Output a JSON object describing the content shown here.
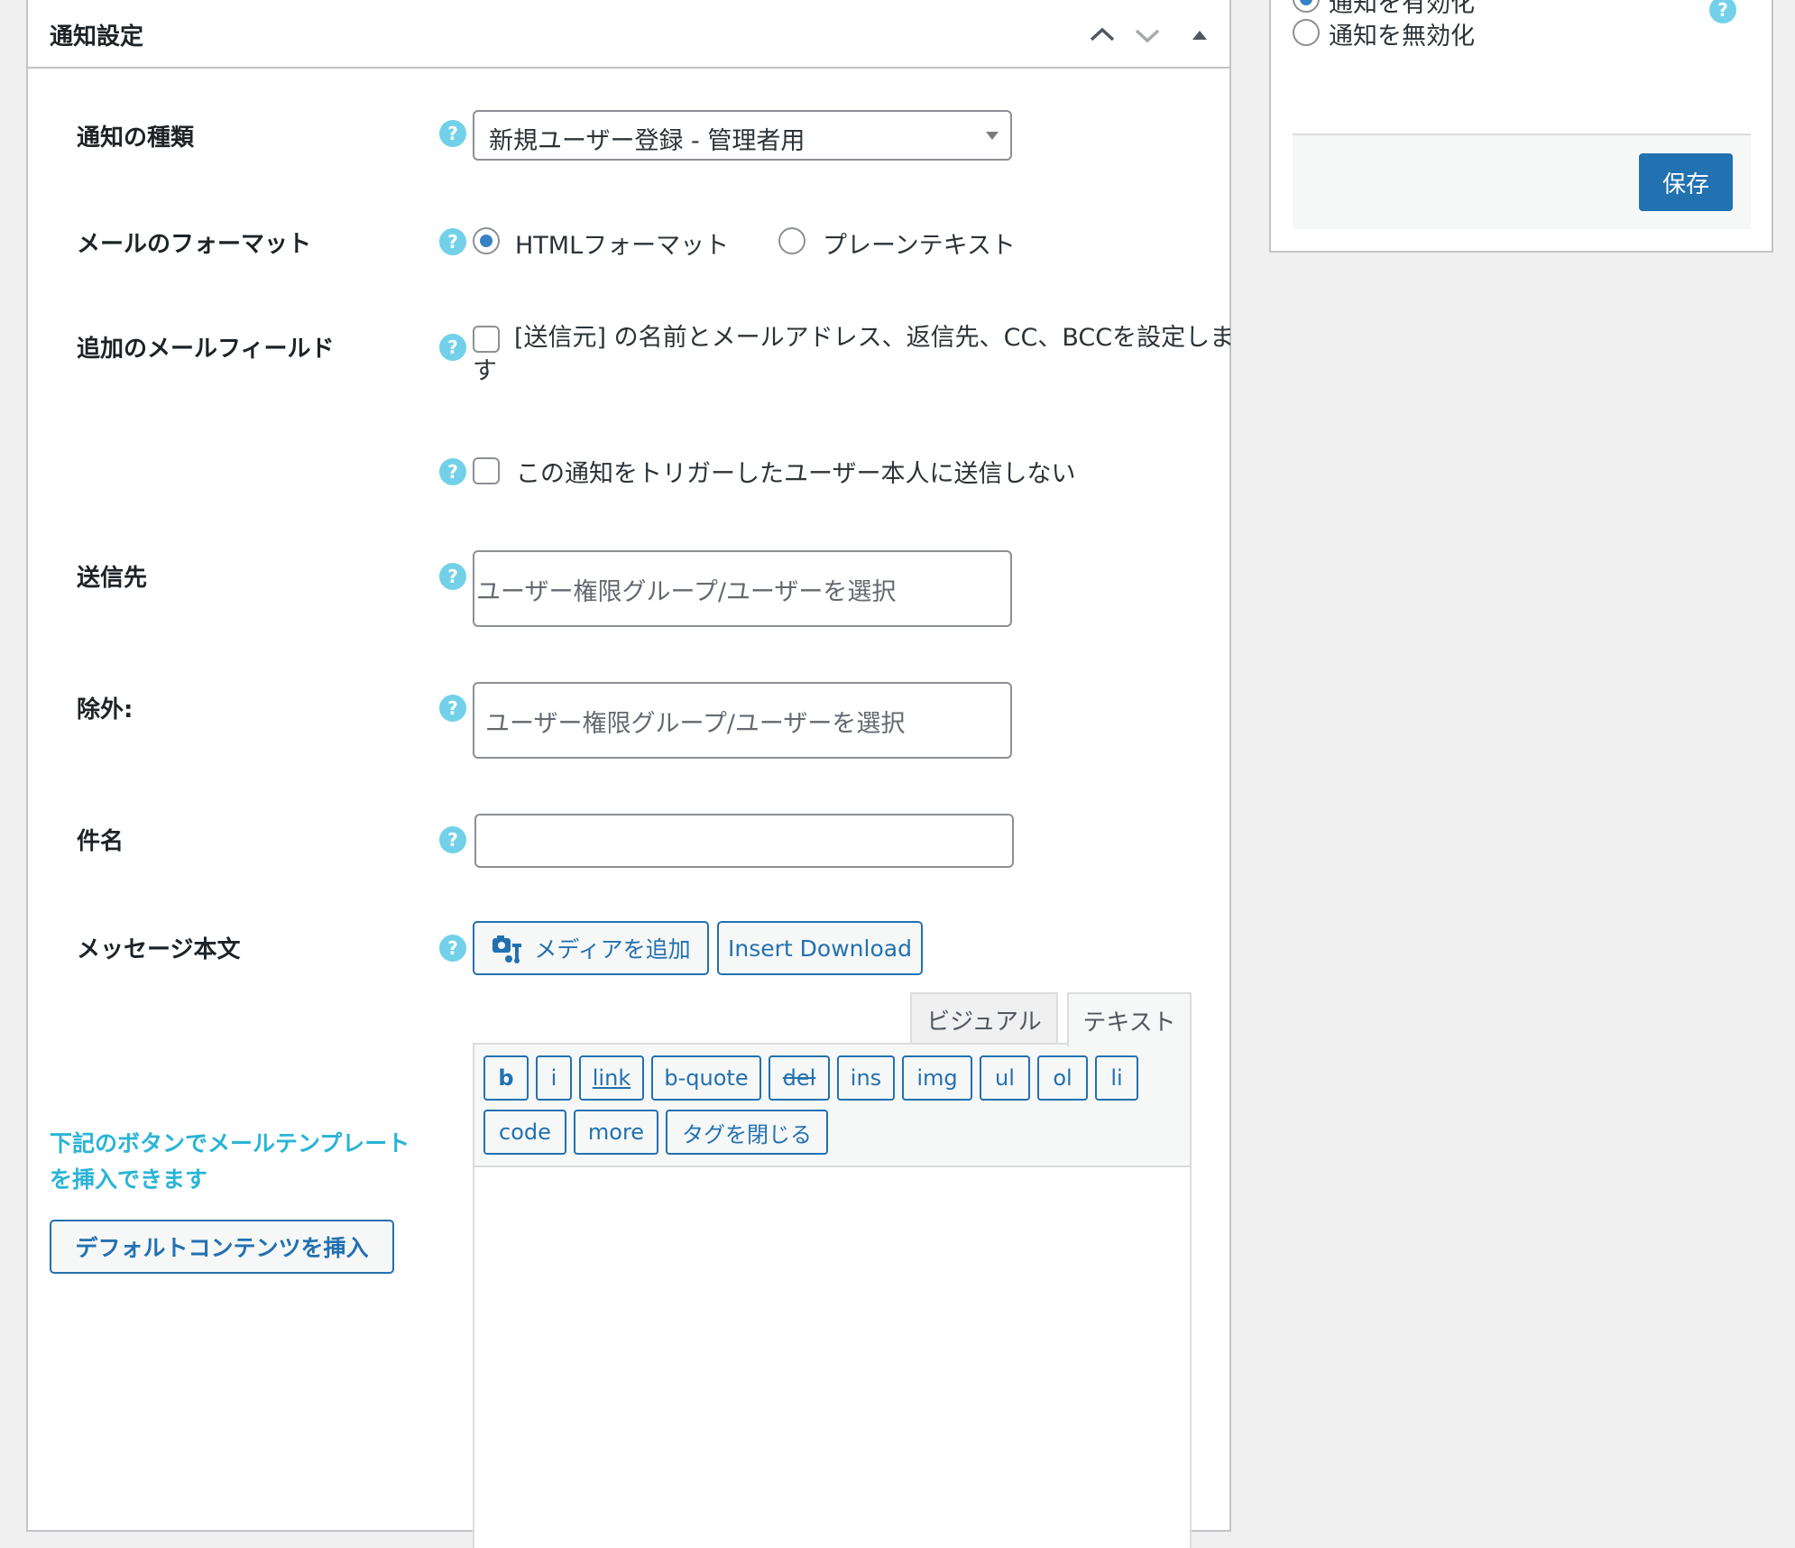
{
  "panel": {
    "title": "通知設定",
    "controls": {
      "move_up": "move-up",
      "move_down": "move-down",
      "toggle": "collapse"
    }
  },
  "rows": {
    "type": {
      "label": "通知の種類",
      "value": "新規ユーザー登録 - 管理者用"
    },
    "format": {
      "label": "メールのフォーマット",
      "options": [
        "HTMLフォーマット",
        "プレーンテキスト"
      ],
      "selected": "HTMLフォーマット"
    },
    "extra": {
      "label": "追加のメールフィールド",
      "checkbox_label": "[送信元] の名前とメールアドレス、返信先、CC、BCCを設定します",
      "checked": false
    },
    "no_self": {
      "checkbox_label": "この通知をトリガーしたユーザー本人に送信しない",
      "checked": false
    },
    "recipients": {
      "label": "送信先",
      "placeholder": "ユーザー権限グループ/ユーザーを選択"
    },
    "exclude": {
      "label": "除外:",
      "placeholder": "ユーザー権限グループ/ユーザーを選択"
    },
    "subject": {
      "label": "件名",
      "value": ""
    },
    "body": {
      "label": "メッセージ本文"
    }
  },
  "help_icon": "?",
  "template": {
    "hint": "下記のボタンでメールテンプレートを挿入できます",
    "insert_button": "デフォルトコンテンツを挿入"
  },
  "editor": {
    "add_media": "メディアを追加",
    "insert_download": "Insert Download",
    "tabs": {
      "visual": "ビジュアル",
      "text": "テキスト",
      "active": "テキスト"
    },
    "quicktags": [
      "b",
      "i",
      "link",
      "b-quote",
      "del",
      "ins",
      "img",
      "ul",
      "ol",
      "li",
      "code",
      "more",
      "タグを閉じる"
    ],
    "content": ""
  },
  "side": {
    "enable_label": "通知を有効化",
    "disable_label": "通知を無効化",
    "selected": "通知を有効化",
    "save": "保存"
  },
  "colors": {
    "accent": "#2271b1",
    "help": "#72d1e8",
    "hint": "#2ab4d6",
    "radio": "#3582c4"
  }
}
